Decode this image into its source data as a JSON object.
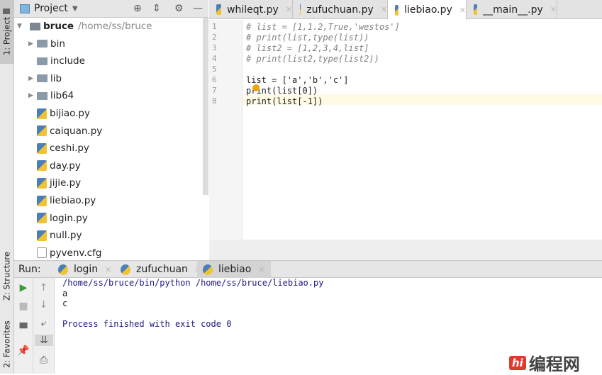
{
  "side_tabs": {
    "project": "1: Project",
    "structure": "Z: Structure",
    "favorites": "2: Favorites"
  },
  "project_panel": {
    "title": "Project",
    "root": {
      "name": "bruce",
      "path": "/home/ss/bruce"
    },
    "items": [
      {
        "name": "bin",
        "type": "folder",
        "expandable": true
      },
      {
        "name": "include",
        "type": "folder",
        "expandable": false
      },
      {
        "name": "lib",
        "type": "folder",
        "expandable": true
      },
      {
        "name": "lib64",
        "type": "folder",
        "expandable": true
      },
      {
        "name": "bijiao.py",
        "type": "py"
      },
      {
        "name": "caiquan.py",
        "type": "py"
      },
      {
        "name": "ceshi.py",
        "type": "py"
      },
      {
        "name": "day.py",
        "type": "py"
      },
      {
        "name": "jijie.py",
        "type": "py"
      },
      {
        "name": "liebiao.py",
        "type": "py"
      },
      {
        "name": "login.py",
        "type": "py"
      },
      {
        "name": "null.py",
        "type": "py"
      },
      {
        "name": "pyvenv.cfg",
        "type": "cfg"
      }
    ]
  },
  "editor_tabs": [
    {
      "label": "whileqt.py",
      "active": false
    },
    {
      "label": "zufuchuan.py",
      "active": false
    },
    {
      "label": "liebiao.py",
      "active": true
    },
    {
      "label": "__main__.py",
      "active": false
    }
  ],
  "code_lines": [
    {
      "n": "1",
      "text": "# list = [1,1.2,True,'westos']"
    },
    {
      "n": "2",
      "text": "# print(list,type(list))"
    },
    {
      "n": "3",
      "text": "# list2 = [1,2,3,4,list]"
    },
    {
      "n": "4",
      "text": "# print(list2,type(list2))"
    },
    {
      "n": "5",
      "text": ""
    },
    {
      "n": "6",
      "text": "list = ['a','b','c']"
    },
    {
      "n": "7",
      "text": "print(list[0])"
    },
    {
      "n": "8",
      "text": "print(list[-1])"
    }
  ],
  "run": {
    "label": "Run:",
    "tabs": [
      {
        "label": "login"
      },
      {
        "label": "zufuchuan"
      },
      {
        "label": "liebiao",
        "active": true
      }
    ],
    "output": [
      "/home/ss/bruce/bin/python /home/ss/bruce/liebiao.py",
      "a",
      "c",
      "",
      "Process finished with exit code 0"
    ]
  },
  "watermark": {
    "logo_text": "编程网"
  },
  "colors": {
    "comment": "#808080",
    "string": "#008080",
    "console_text": "#1a1a80",
    "run_green": "#3c9a3c"
  }
}
